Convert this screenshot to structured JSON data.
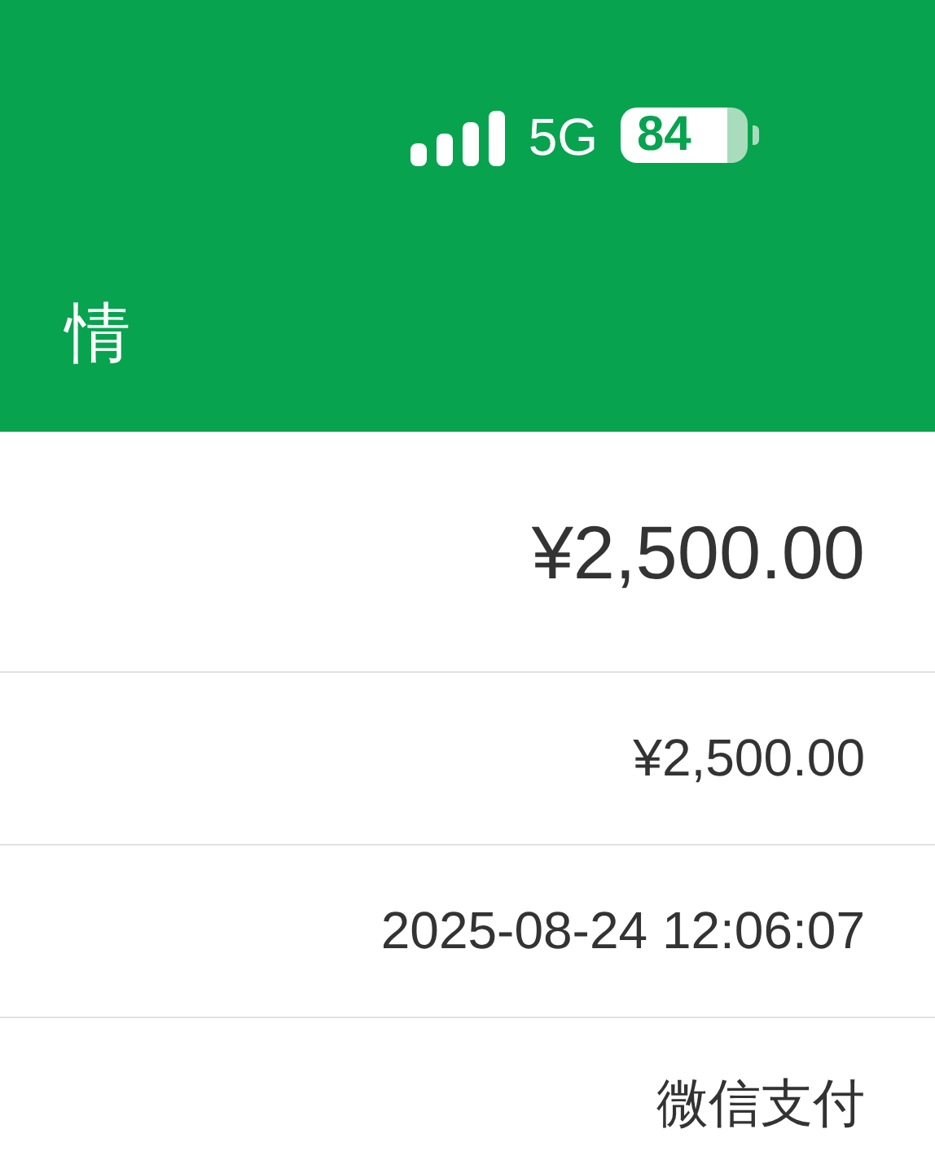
{
  "status_bar": {
    "network": "5G",
    "battery": "84"
  },
  "header": {
    "title": "情"
  },
  "rows": [
    {
      "kind": "total",
      "value": "¥2,500.00"
    },
    {
      "kind": "detail",
      "value": "¥2,500.00"
    },
    {
      "kind": "detail",
      "value": "2025-08-24 12:06:07"
    },
    {
      "kind": "detail",
      "value": "微信支付"
    }
  ]
}
